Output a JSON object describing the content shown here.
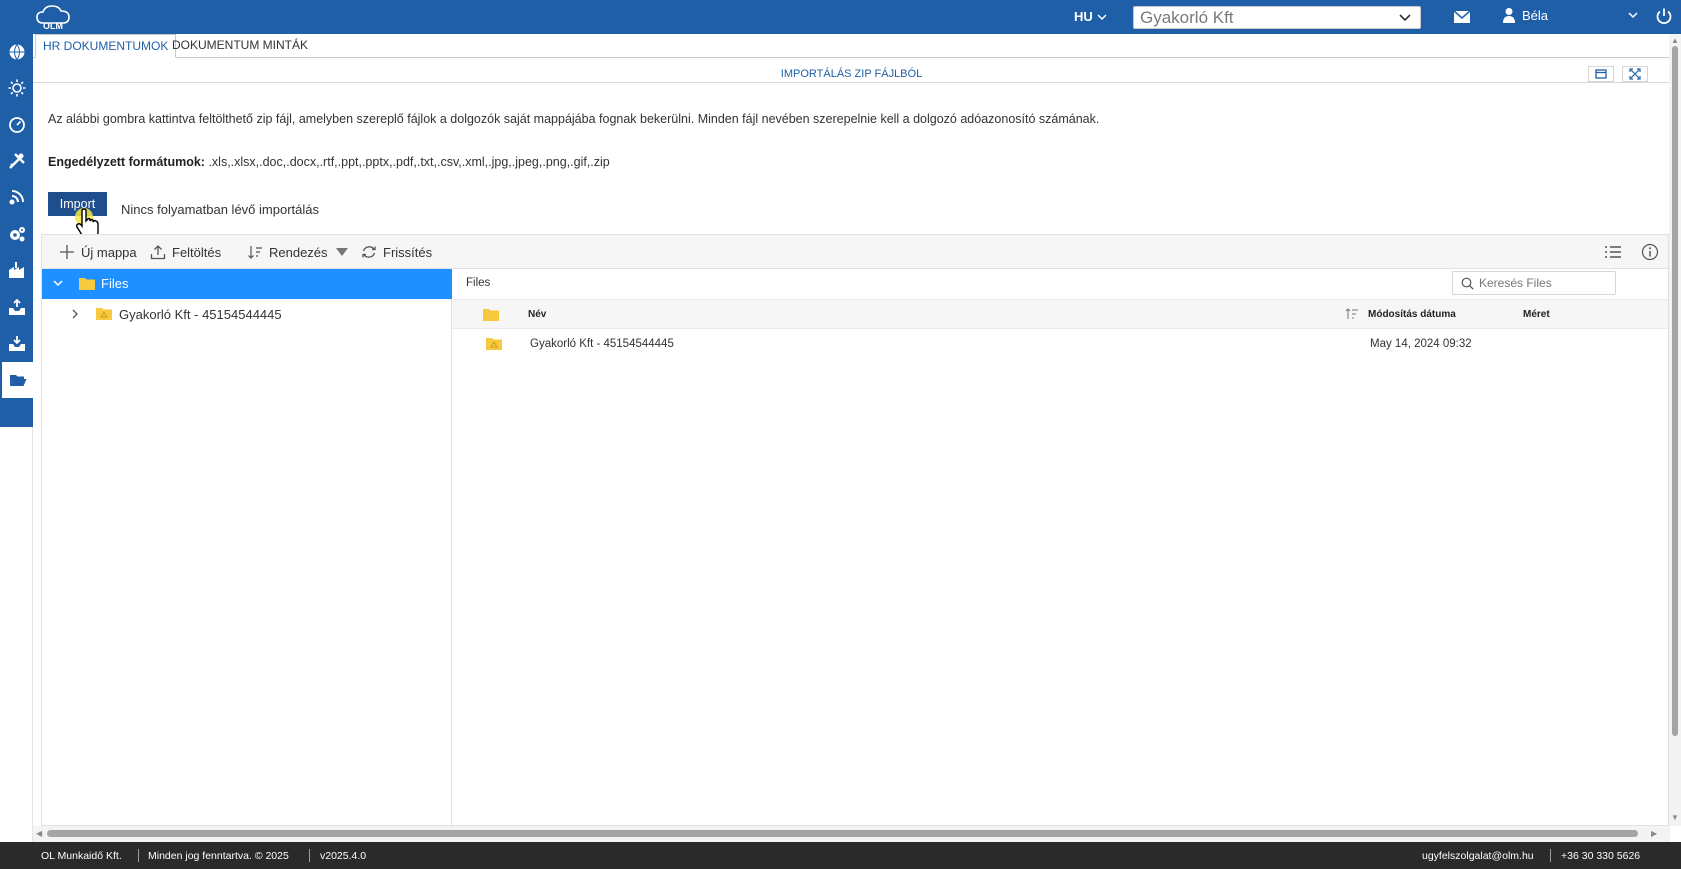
{
  "header": {
    "logo_text": "OLM",
    "language": "HU",
    "company": "Gyakorló Kft",
    "user_name": "Béla"
  },
  "sidebar": {
    "icons": [
      "globe-icon",
      "sun-icon",
      "gauge-icon",
      "tools-icon",
      "network-icon",
      "settings-icon",
      "factory-icon",
      "inbox-upload-icon",
      "inbox-download-icon",
      "folder-open-icon"
    ],
    "active": "folder-open-icon"
  },
  "tabs": [
    {
      "label": "HR DOKUMENTUMOK",
      "active": true
    },
    {
      "label": "DOKUMENTUM MINTÁK",
      "active": false
    }
  ],
  "import_panel": {
    "title": "IMPORTÁLÁS ZIP FÁJLBÓL",
    "description": "Az alábbi gombra kattintva feltölthető zip fájl, amelyben szereplő fájlok a dolgozók saját mappájába fognak bekerülni. Minden fájl nevében szerepelnie kell a dolgozó adóazonosító számának.",
    "formats_label": "Engedélyzett formátumok:",
    "formats_value": " .xls,.xlsx,.doc,.docx,.rtf,.ppt,.pptx,.pdf,.txt,.csv,.xml,.jpg,.jpeg,.png,.gif,.zip",
    "import_button": "Import",
    "status": "Nincs folyamatban lévő importálás"
  },
  "file_manager": {
    "toolbar": {
      "new_folder": "Új mappa",
      "upload": "Feltöltés",
      "sort": "Rendezés",
      "refresh": "Frissítés"
    },
    "tree": {
      "root": "Files",
      "children": [
        "Gyakorló Kft - 45154544445"
      ]
    },
    "breadcrumb": "Files",
    "search_placeholder": "Keresés Files",
    "columns": {
      "name": "Név",
      "modified": "Módosítás dátuma",
      "size": "Méret"
    },
    "rows": [
      {
        "name": "Gyakorló Kft - 45154544445",
        "modified": "May 14, 2024 09:32",
        "size": ""
      }
    ]
  },
  "footer": {
    "company": "OL Munkaidő Kft.",
    "rights": "Minden jog fenntartva. © 2025",
    "version": "v2025.4.0",
    "email": "ugyfelszolgalat@olm.hu",
    "phone": "+36 30 330 5626"
  },
  "colors": {
    "brand_blue": "#1f5fa8",
    "selection_blue": "#1e90ff",
    "folder_yellow": "#f6c93f",
    "footer_bg": "#2a2a2a"
  }
}
